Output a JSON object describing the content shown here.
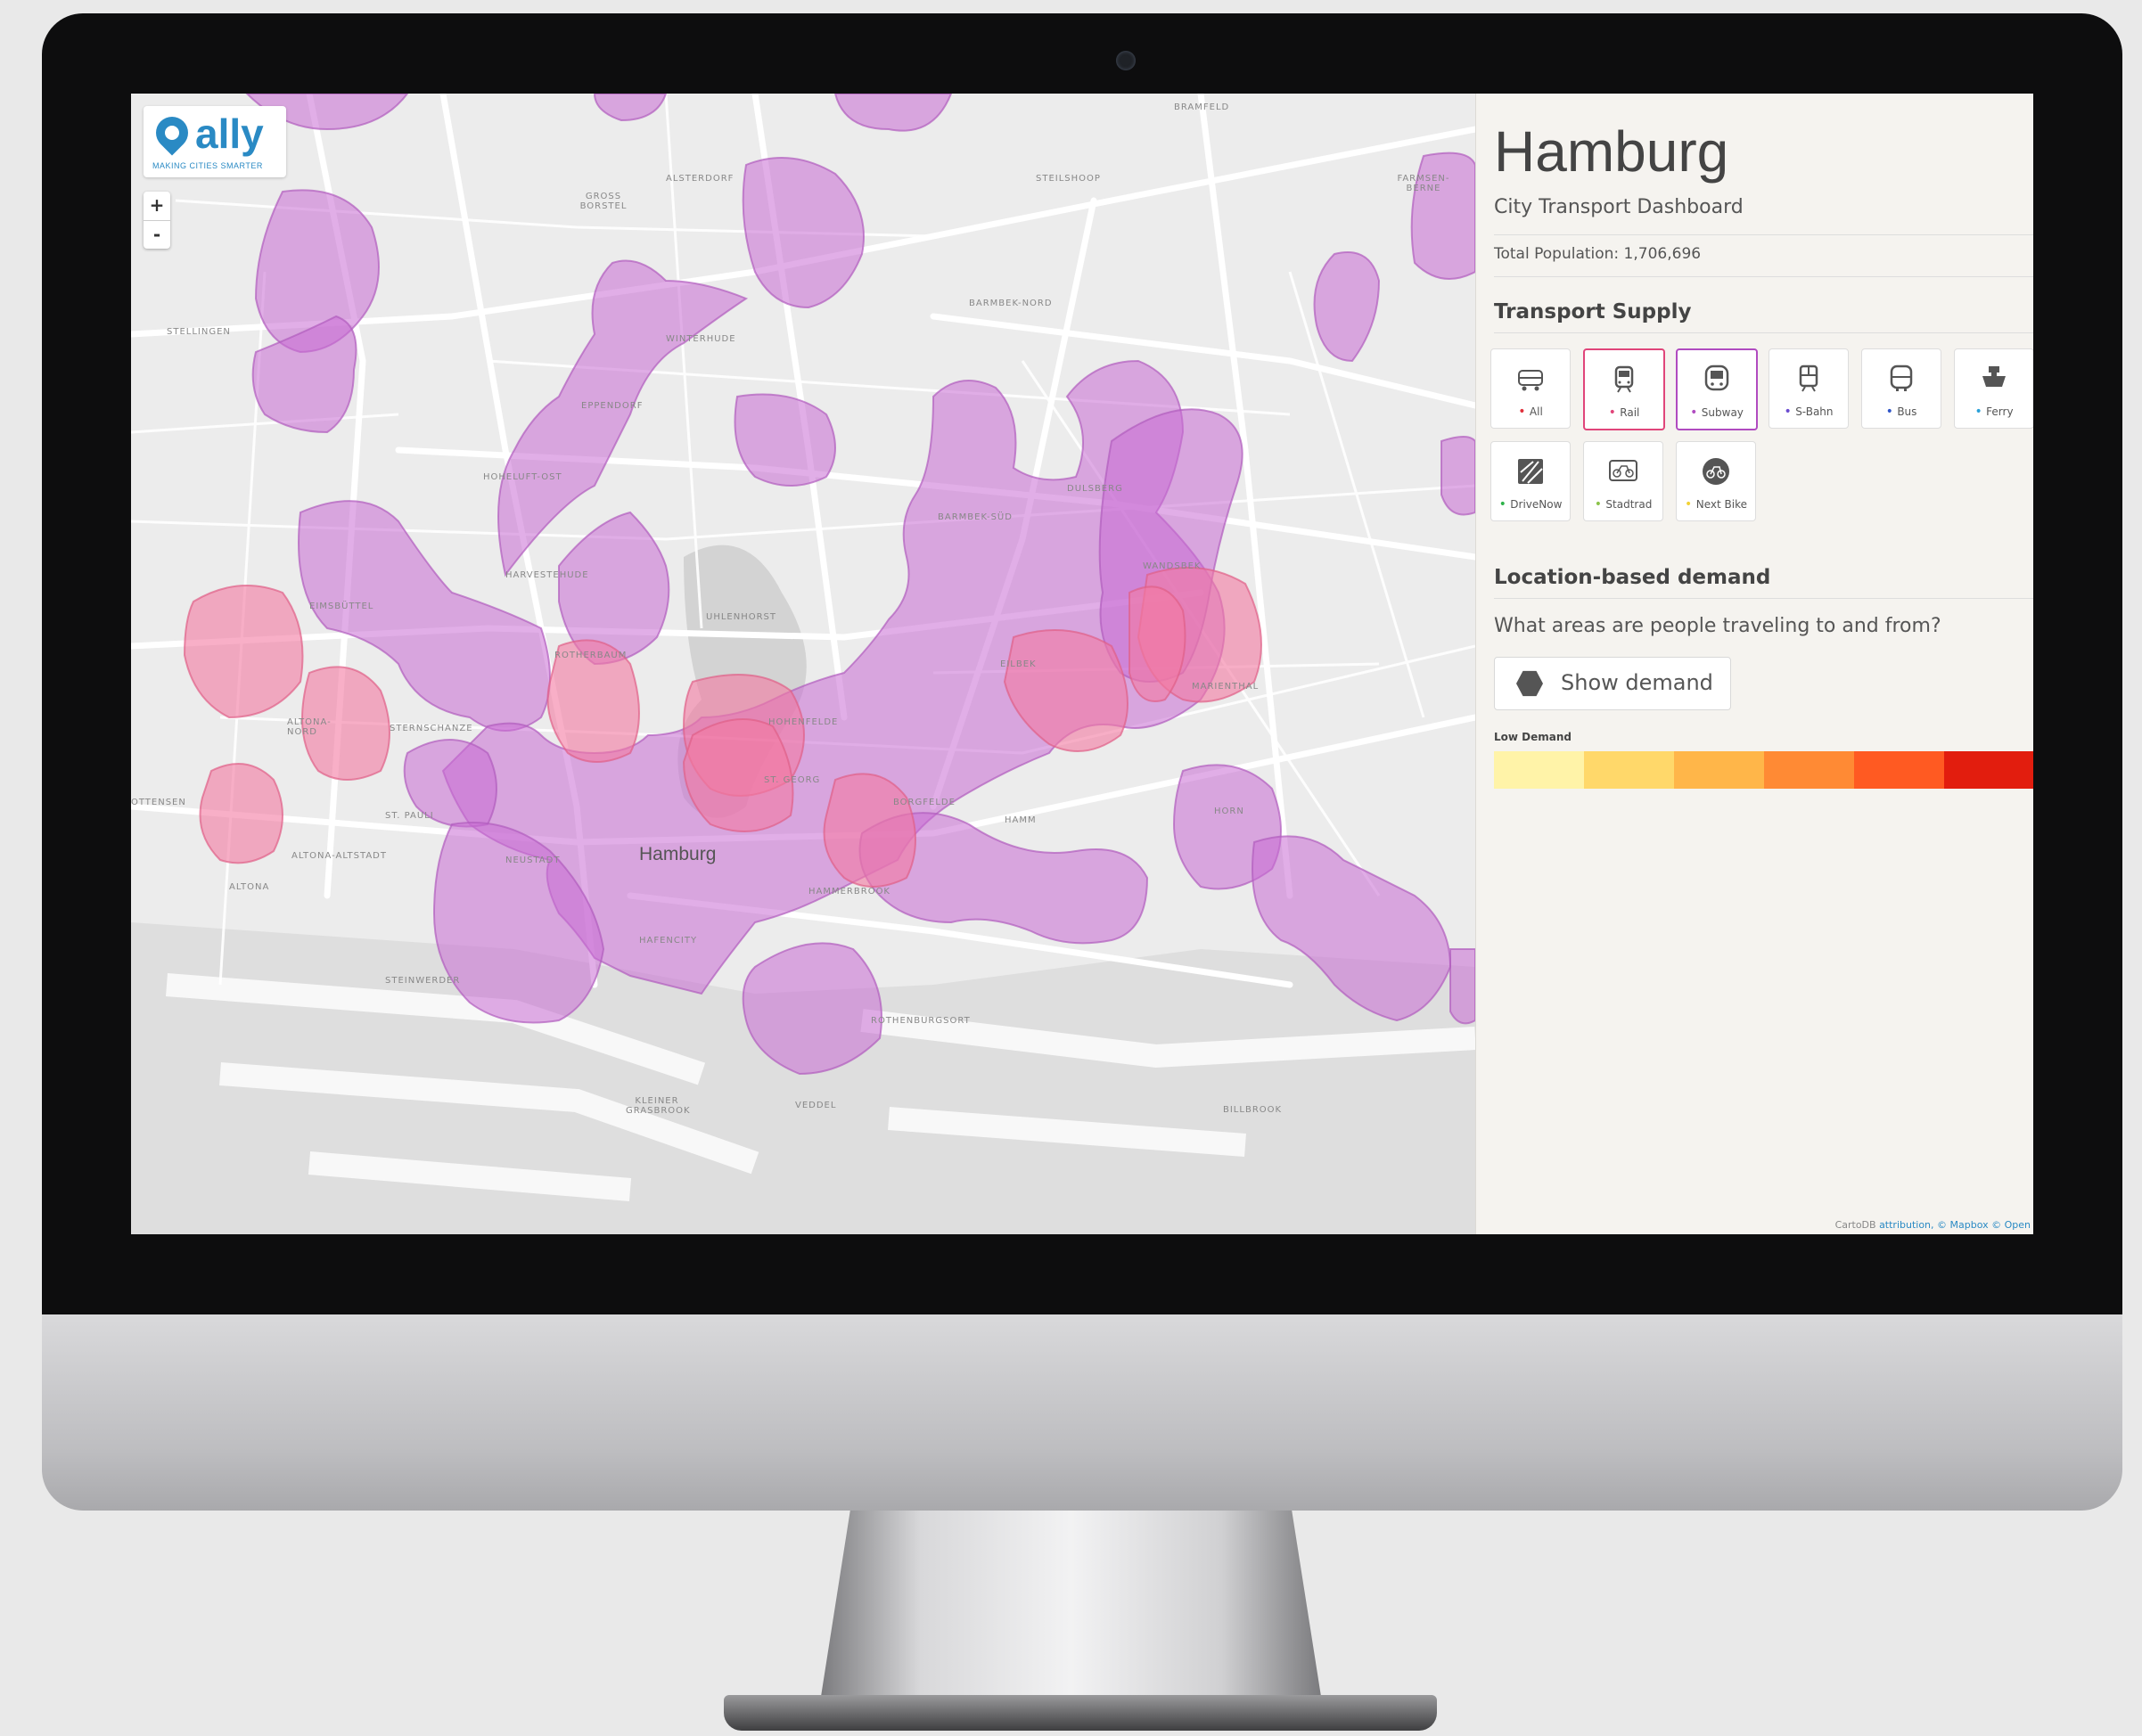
{
  "logo": {
    "name": "ally",
    "tagline": "MAKING CITIES SMARTER"
  },
  "zoom": {
    "in": "+",
    "out": "-"
  },
  "map": {
    "city_label": "Hamburg",
    "labels": [
      "STELLINGEN",
      "EIMSBÜTTEL",
      "ALTONA-NORD",
      "STERNSCHANZE",
      "ST. PAULI",
      "NEUSTADT",
      "ALTONA-ALTSTADT",
      "HARVESTEHUDE",
      "ROTHERBAUM",
      "HOHELUFT-OST",
      "EPPENDORF",
      "WINTERHUDE",
      "BARMBEK-NORD",
      "BARMBEK-SÜD",
      "UHLENHORST",
      "HOHENFELDE",
      "DULSBERG",
      "EILBEK",
      "MARIENTHAL",
      "WANDSBEK",
      "HAMMERBROOK",
      "ROTHENBURGSORT",
      "STEINWERDER",
      "KLEINER GRASBROOK",
      "VEDDEL",
      "BILLBROOK",
      "HORN",
      "HAMM",
      "BORGFELDE",
      "ALTONA",
      "GROSS BORSTEL",
      "ALSTERDORF",
      "STEILSHOOP",
      "BRAMFELD",
      "OTTENSEN",
      "HAFENCITY",
      "ST. GEORG",
      "FARMSEN-BERNE"
    ],
    "layer_colors": {
      "supply": "#c86bd4",
      "rail": "#f37aa2",
      "overlap": "#e24fa4"
    }
  },
  "panel": {
    "title": "Hamburg",
    "subtitle": "City Transport Dashboard",
    "population": "Total Population: 1,706,696",
    "supply_title": "Transport Supply",
    "modes": [
      {
        "label": "All",
        "dot": "#e0303a",
        "icon": "all-transport-icon"
      },
      {
        "label": "Rail",
        "dot": "#e0457a",
        "icon": "train-icon"
      },
      {
        "label": "Subway",
        "dot": "#b04bc0",
        "icon": "subway-icon"
      },
      {
        "label": "S-Bahn",
        "dot": "#6a4bd0",
        "icon": "sbahn-icon"
      },
      {
        "label": "Bus",
        "dot": "#2f55c8",
        "icon": "bus-icon"
      },
      {
        "label": "Ferry",
        "dot": "#2aa0d8",
        "icon": "ferry-icon"
      },
      {
        "label": "DriveNow",
        "dot": "#2eb24a",
        "icon": "carsharing-icon"
      },
      {
        "label": "Stadtrad",
        "dot": "#8bc34a",
        "icon": "bike-rack-icon"
      },
      {
        "label": "Next Bike",
        "dot": "#f2d235",
        "icon": "bike-icon"
      }
    ],
    "demand_title": "Location-based demand",
    "demand_question": "What areas are people traveling to and from?",
    "show_demand": "Show demand",
    "legend_low": "Low Demand",
    "legend_colors": [
      "#fff3a8",
      "#ffd86a",
      "#ffb649",
      "#ff8a34",
      "#ff5a22",
      "#e21d0e"
    ],
    "attribution_prefix": "CartoDB ",
    "attribution_links": "attribution, © Mapbox © Open"
  }
}
